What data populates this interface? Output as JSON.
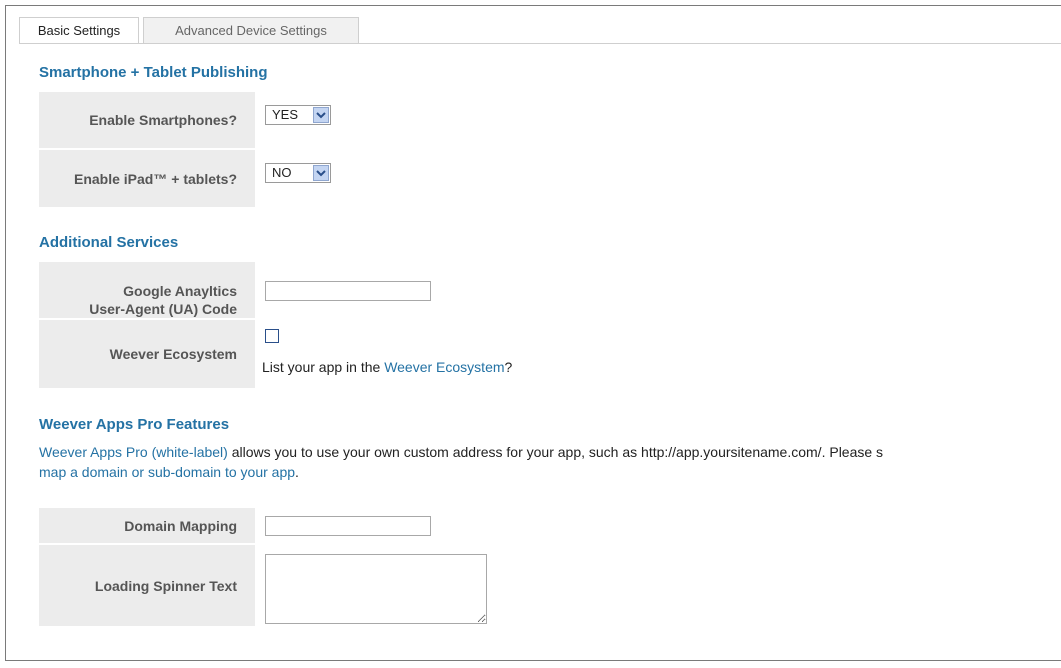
{
  "tabs": [
    {
      "label": "Basic Settings",
      "active": true
    },
    {
      "label": "Advanced Device Settings",
      "active": false
    }
  ],
  "sections": {
    "publishing": {
      "title": "Smartphone + Tablet Publishing",
      "smartphones": {
        "label": "Enable Smartphones?",
        "value": "YES"
      },
      "tablets": {
        "label": "Enable iPad™ + tablets?",
        "value": "NO"
      }
    },
    "services": {
      "title": "Additional Services",
      "analytics": {
        "label_line1": "Google Anayltics",
        "label_line2": "User-Agent (UA) Code",
        "value": ""
      },
      "ecosystem": {
        "label": "Weever Ecosystem",
        "checked": false,
        "text_before": "List your app in the ",
        "link": "Weever Ecosystem",
        "text_after": "?"
      }
    },
    "pro": {
      "title": "Weever Apps Pro Features",
      "desc_link": "Weever Apps Pro (white-label)",
      "desc_text": " allows you to use your own custom address for your app, such as http://app.yoursitename.com/. Please s",
      "desc_link2": "map a domain or sub-domain to your app",
      "desc_end": ".",
      "domain": {
        "label": "Domain Mapping",
        "value": ""
      },
      "spinner": {
        "label": "Loading Spinner Text",
        "value": ""
      }
    }
  },
  "colors": {
    "accent": "#2472a4",
    "label_bg": "#ececec"
  },
  "icons": {
    "select_arrow": "chevron-down-icon"
  }
}
